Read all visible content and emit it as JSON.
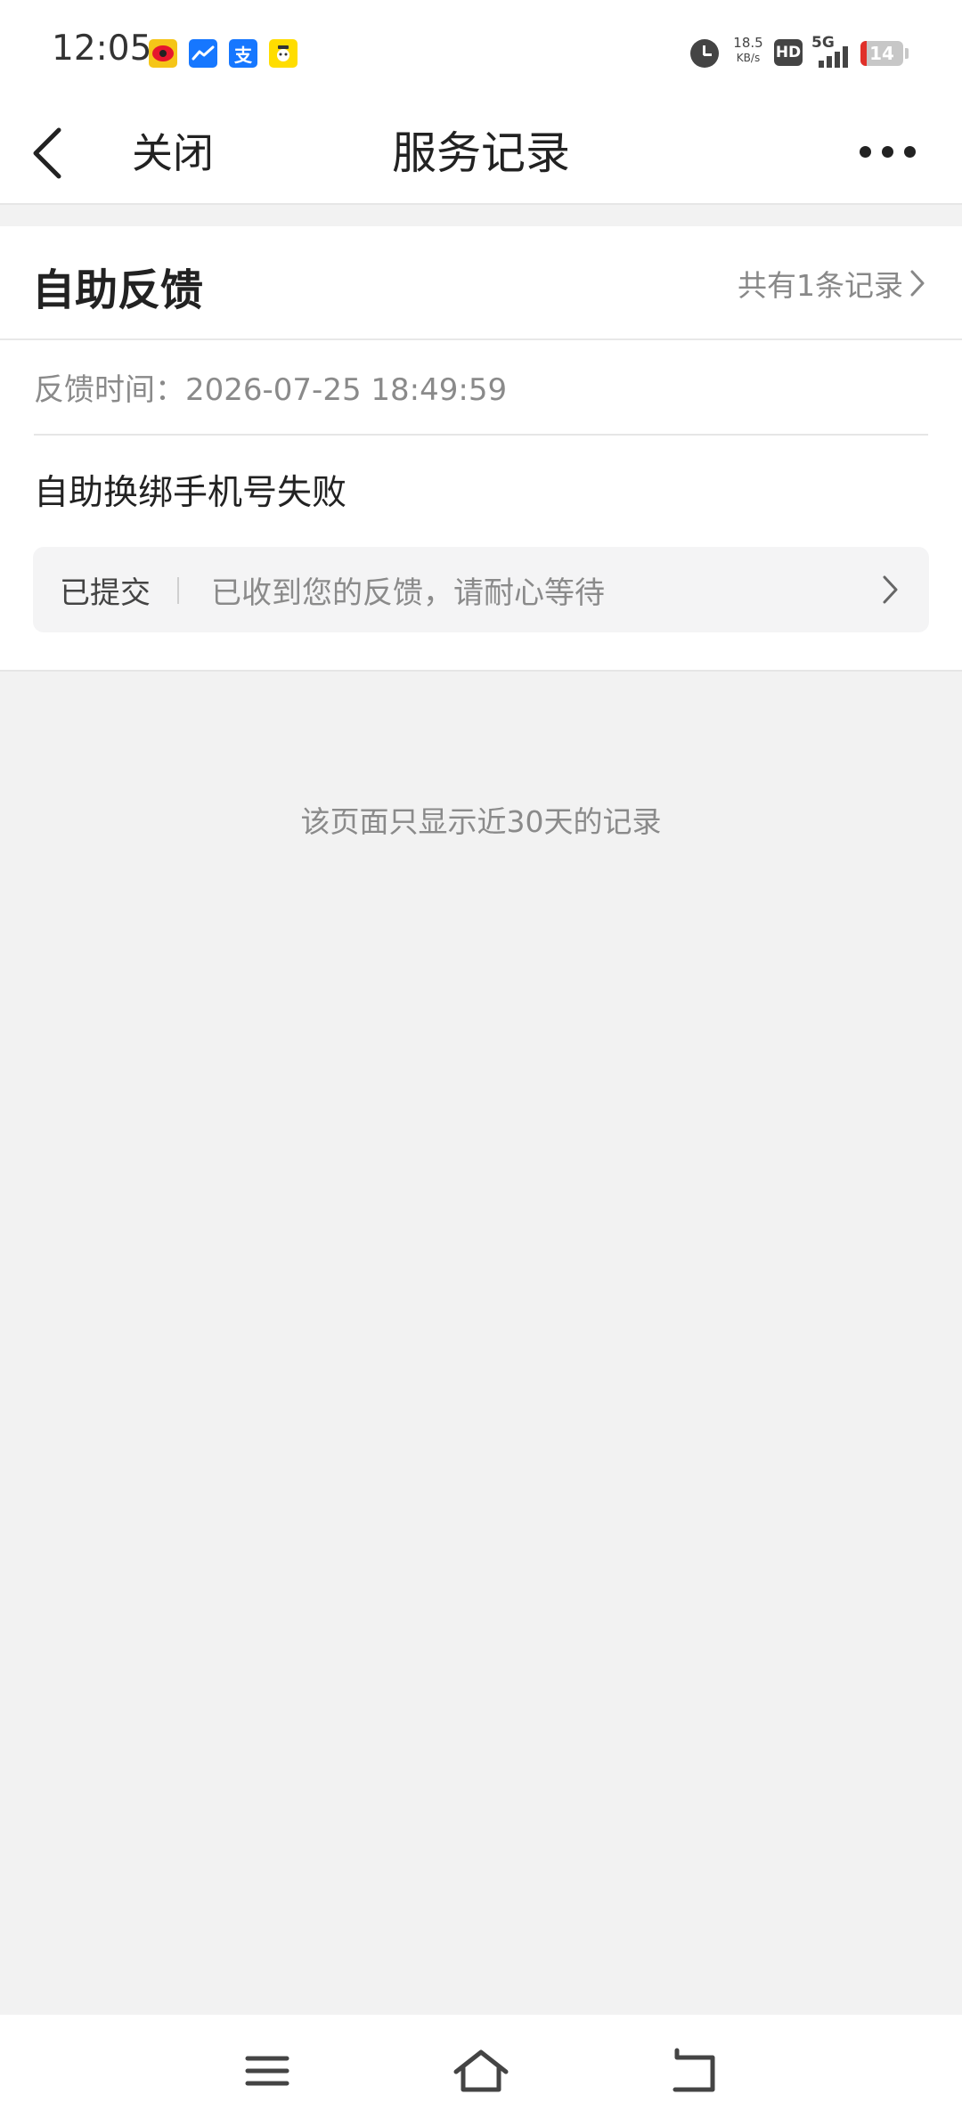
{
  "status_bar": {
    "time": "12:05",
    "app_icons": [
      "weibo-icon",
      "trend-icon",
      "alipay-icon",
      "yellow-app-icon"
    ],
    "alipay_glyph": "支",
    "net_speed_value": "18.5",
    "net_speed_unit": "KB/s",
    "hd_badge": "HD",
    "network_type": "5G",
    "battery_level": "14",
    "battery_fraction": 0.14
  },
  "nav": {
    "close_label": "关闭",
    "title": "服务记录"
  },
  "card": {
    "title": "自助反馈",
    "record_count_label": "共有1条记录",
    "feedback_time_label": "反馈时间：",
    "feedback_time_value": "2026-07-25 18:49:59",
    "subject": "自助换绑手机号失败",
    "status_label": "已提交",
    "status_message": "已收到您的反馈，请耐心等待"
  },
  "footer_note": "该页面只显示近30天的记录",
  "colors": {
    "background": "#f2f2f2",
    "card": "#ffffff",
    "primary_text": "#222222",
    "secondary_text": "#8a8a8a",
    "status_row_bg": "#f4f4f5",
    "battery_low": "#e0302a"
  }
}
